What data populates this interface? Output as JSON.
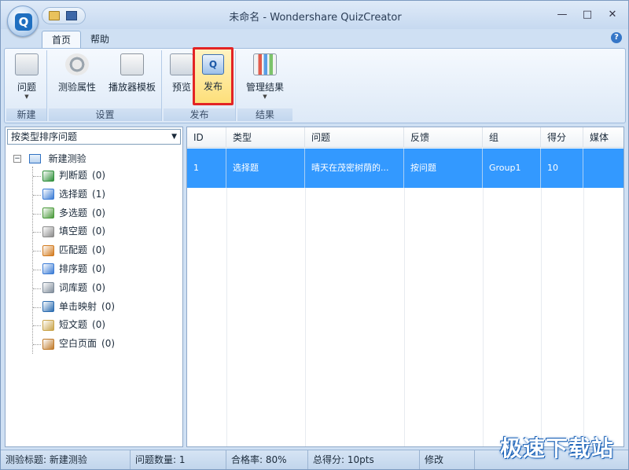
{
  "window": {
    "title": "未命名 - Wondershare QuizCreator",
    "app_logo": "Q",
    "controls": [
      "—",
      "□",
      "✕"
    ]
  },
  "ribbon": {
    "tabs": [
      {
        "label": "首页",
        "active": true
      },
      {
        "label": "帮助",
        "active": false
      }
    ],
    "groups": [
      {
        "label": "新建",
        "buttons": [
          {
            "label": "问题",
            "icon": "question-icon",
            "dropdown": true
          }
        ]
      },
      {
        "label": "设置",
        "buttons": [
          {
            "label": "测验属性",
            "icon": "gear-icon"
          },
          {
            "label": "播放器模板",
            "icon": "template-icon"
          }
        ]
      },
      {
        "label": "发布",
        "buttons": [
          {
            "label": "预览",
            "icon": "preview-icon"
          },
          {
            "label": "发布",
            "icon": "publish-icon",
            "highlighted": true
          }
        ]
      },
      {
        "label": "结果",
        "buttons": [
          {
            "label": "管理结果",
            "icon": "chart-icon",
            "dropdown": true
          }
        ]
      }
    ]
  },
  "left_panel": {
    "sort_select": "按类型排序问题",
    "tree": {
      "root": "新建测验",
      "items": [
        {
          "label": "判断题",
          "count": "(0)",
          "icon": "true-false-icon",
          "color": "#2f8f3a"
        },
        {
          "label": "选择题",
          "count": "(1)",
          "icon": "multiple-choice-icon",
          "color": "#3a7bd5"
        },
        {
          "label": "多选题",
          "count": "(0)",
          "icon": "multiple-response-icon",
          "color": "#4a9a3a"
        },
        {
          "label": "填空题",
          "count": "(0)",
          "icon": "fill-blank-icon",
          "color": "#8a8a8a"
        },
        {
          "label": "匹配题",
          "count": "(0)",
          "icon": "matching-icon",
          "color": "#d27a1e"
        },
        {
          "label": "排序题",
          "count": "(0)",
          "icon": "sequence-icon",
          "color": "#3a7bd5"
        },
        {
          "label": "词库题",
          "count": "(0)",
          "icon": "word-bank-icon",
          "color": "#7f8c9a"
        },
        {
          "label": "单击映射",
          "count": "(0)",
          "icon": "click-map-icon",
          "color": "#2b6cb0"
        },
        {
          "label": "短文题",
          "count": "(0)",
          "icon": "short-essay-icon",
          "color": "#c9a44a"
        },
        {
          "label": "空白页面",
          "count": "(0)",
          "icon": "blank-page-icon",
          "color": "#c07a2a"
        }
      ]
    }
  },
  "table": {
    "columns": [
      "ID",
      "类型",
      "问题",
      "反馈",
      "组",
      "得分",
      "媒体"
    ],
    "rows": [
      {
        "id": "1",
        "type": "选择题",
        "question": "晴天在茂密树荫的...",
        "feedback": "按问题",
        "group": "Group1",
        "score": "10",
        "media": ""
      }
    ]
  },
  "statusbar": {
    "quiz_title": "测验标题: 新建测验",
    "question_count": "问题数量: 1",
    "pass_rate": "合格率: 80%",
    "total_score": "总得分: 10pts",
    "modified": "修改"
  },
  "watermark": "极速下载站"
}
